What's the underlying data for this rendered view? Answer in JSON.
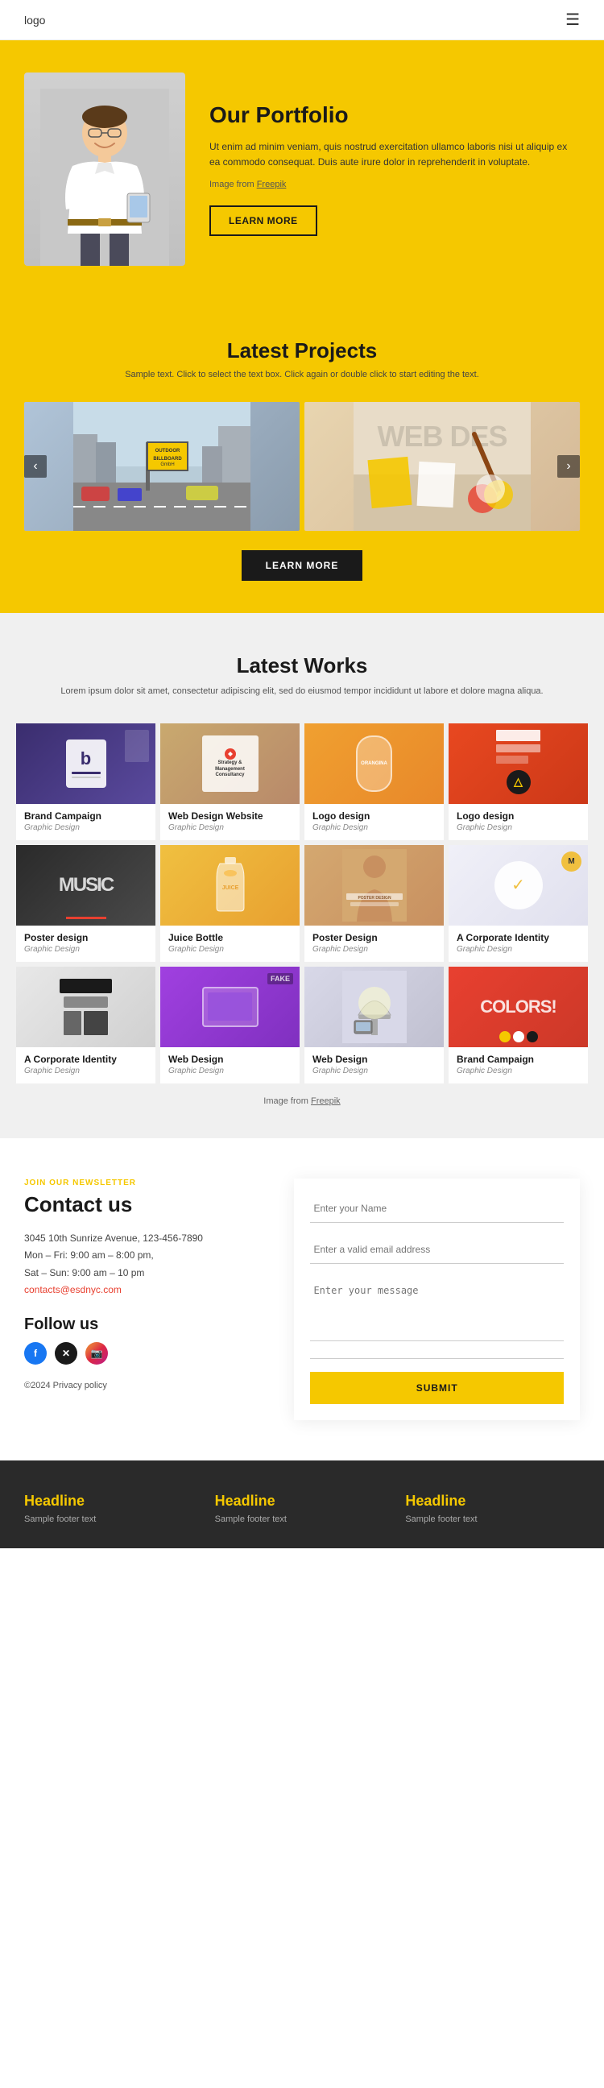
{
  "header": {
    "logo": "logo",
    "hamburger_icon": "☰"
  },
  "hero": {
    "title": "Our Portfolio",
    "description": "Ut enim ad minim veniam, quis nostrud exercitation ullamco laboris nisi ut aliquip ex ea commodo consequat. Duis aute irure dolor in reprehenderit in voluptate.",
    "image_credit_prefix": "Image from",
    "image_credit_link": "Freepik",
    "learn_more_button": "LEARN MORE"
  },
  "latest_projects": {
    "title": "Latest Projects",
    "subtitle": "Sample text. Click to select the text box. Click again or double click to start editing the text.",
    "carousel_left": "‹",
    "carousel_right": "›",
    "image1_label": "Outdoor Billboard",
    "image2_label": "WEB DES",
    "learn_more_button": "LEARN MORE"
  },
  "latest_works": {
    "title": "Latest Works",
    "subtitle": "Lorem ipsum dolor sit amet, consectetur adipiscing elit, sed do eiusmod tempor\nincididunt ut labore et dolore magna aliqua.",
    "image_credit_prefix": "Image from",
    "image_credit_link": "Freepik",
    "items": [
      {
        "title": "Brand Campaign",
        "category": "Graphic Design",
        "thumb": "brand-campaign"
      },
      {
        "title": "Web Design Website",
        "category": "Graphic Design",
        "thumb": "web-design-website"
      },
      {
        "title": "Logo design",
        "category": "Graphic Design",
        "thumb": "logo-design-juice"
      },
      {
        "title": "Logo design",
        "category": "Graphic Design",
        "thumb": "logo-design-corp"
      },
      {
        "title": "Poster design",
        "category": "Graphic Design",
        "thumb": "poster-design"
      },
      {
        "title": "Juice Bottle",
        "category": "Graphic Design",
        "thumb": "juice-bottle"
      },
      {
        "title": "Poster Design",
        "category": "Graphic Design",
        "thumb": "poster-design2"
      },
      {
        "title": "A Corporate Identity",
        "category": "Graphic Design",
        "thumb": "corporate-identity"
      },
      {
        "title": "A Corporate Identity",
        "category": "Graphic Design",
        "thumb": "corporate-identity2"
      },
      {
        "title": "Web Design",
        "category": "Graphic Design",
        "thumb": "web-design-fake"
      },
      {
        "title": "Web Design",
        "category": "Graphic Design",
        "thumb": "web-design-lamp"
      },
      {
        "title": "Brand Campaign",
        "category": "Graphic Design",
        "thumb": "brand-campaign2"
      }
    ]
  },
  "contact": {
    "join_label": "JOIN OUR NEWSLETTER",
    "title": "Contact us",
    "address": "3045 10th Sunrize Avenue, 123-456-7890",
    "hours1": "Mon – Fri: 9:00 am – 8:00 pm,",
    "hours2": "Sat – Sun: 9:00 am – 10 pm",
    "email": "contacts@esdnyc.com",
    "follow_title": "Follow us",
    "copyright": "©2024 Privacy policy",
    "form": {
      "name_placeholder": "Enter your Name",
      "email_placeholder": "Enter a valid email address",
      "message_placeholder": "Enter your message",
      "submit_button": "SUBMIT"
    }
  },
  "footer": {
    "columns": [
      {
        "headline": "Headline",
        "text": "Sample footer text"
      },
      {
        "headline": "Headline",
        "text": "Sample footer text"
      },
      {
        "headline": "Headline",
        "text": "Sample footer text"
      }
    ]
  }
}
